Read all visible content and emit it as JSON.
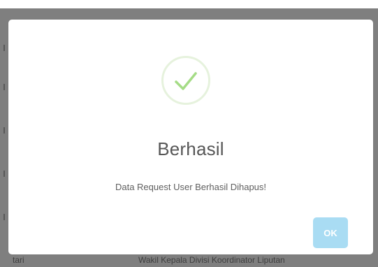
{
  "dialog": {
    "icon": "success-check-icon",
    "title": "Berhasil",
    "message": "Data Request User Berhasil Dihapus!",
    "confirm_label": "OK",
    "colors": {
      "icon_stroke": "#a5dc86",
      "icon_ring": "#e6f2dd",
      "confirm_button": "#a9dcf3",
      "overlay": "#7f7f7f"
    }
  },
  "background": {
    "row_left_text": "tari",
    "row_center_text": "Wakil Kepala Divisi Koordinator Liputan"
  }
}
